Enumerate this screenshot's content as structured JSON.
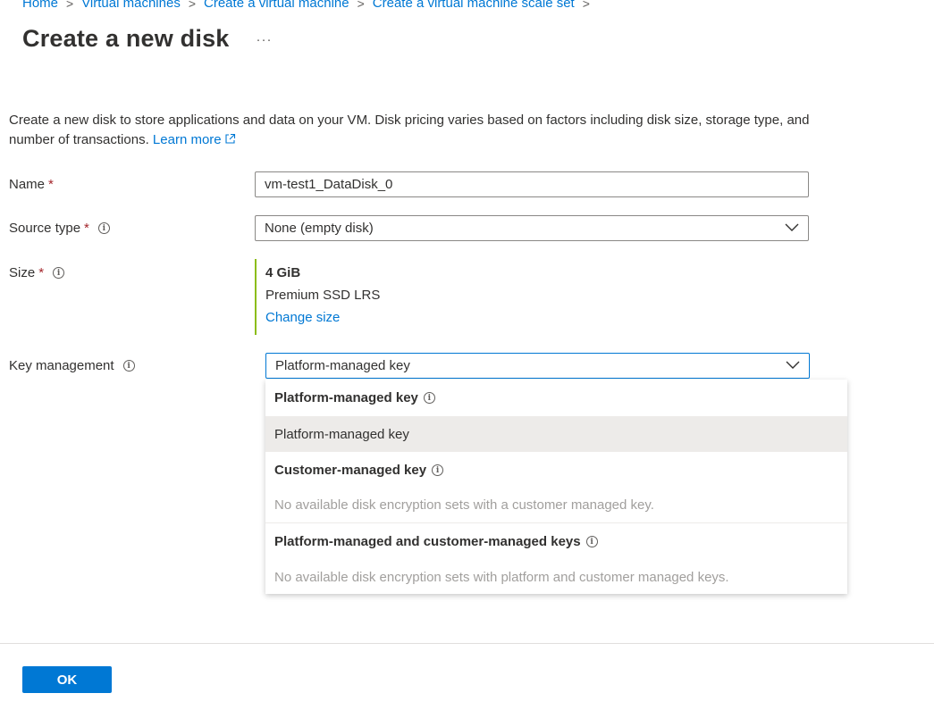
{
  "breadcrumb": {
    "items": [
      "Home",
      "Virtual machines",
      "Create a virtual machine",
      "Create a virtual machine scale set"
    ]
  },
  "page": {
    "title": "Create a new disk",
    "more": "···"
  },
  "description": {
    "text": "Create a new disk to store applications and data on your VM. Disk pricing varies based on factors including disk size, storage type, and number of transactions.",
    "link": "Learn more"
  },
  "form": {
    "name_label": "Name",
    "name_value": "vm-test1_DataDisk_0",
    "source_type_label": "Source type",
    "source_type_value": "None (empty disk)",
    "size_label": "Size",
    "size_value": "4 GiB",
    "size_sku": "Premium SSD LRS",
    "size_change": "Change size",
    "key_mgmt_label": "Key management",
    "key_mgmt_value": "Platform-managed key",
    "required_mark": "*"
  },
  "dropdown": {
    "group1_header": "Platform-managed key",
    "group1_option": "Platform-managed key",
    "group2_header": "Customer-managed key",
    "group2_empty": "No available disk encryption sets with a customer managed key.",
    "group3_header": "Platform-managed and customer-managed keys",
    "group3_empty": "No available disk encryption sets with platform and customer managed keys."
  },
  "footer": {
    "ok_label": "OK"
  },
  "colors": {
    "accent": "#0078d4",
    "required": "#a4262c",
    "size_border": "#8cbd18"
  }
}
